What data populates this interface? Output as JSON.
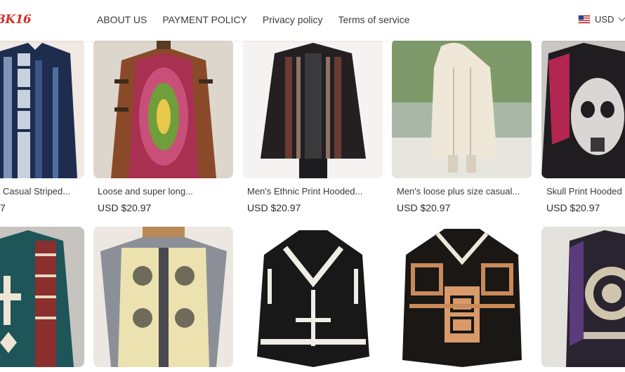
{
  "header": {
    "logo_text": "3K16",
    "nav": [
      "ABOUT US",
      "PAYMENT POLICY",
      "Privacy policy",
      "Terms of service"
    ],
    "currency": "USD"
  },
  "products_row1": [
    {
      "title": "Casual Striped...",
      "price": "7"
    },
    {
      "title": "Loose and super long...",
      "price": "USD $20.97"
    },
    {
      "title": "Men's Ethnic Print Hooded...",
      "price": "USD $20.97"
    },
    {
      "title": "Men's loose plus size casual...",
      "price": "USD $20.97"
    },
    {
      "title": "Skull Print Hooded",
      "price": "USD $20.97"
    }
  ],
  "products_row2": [
    {
      "image": "teal-cross-poncho"
    },
    {
      "image": "grey-beige-patterned-poncho"
    },
    {
      "image": "black-white-aztec-poncho"
    },
    {
      "image": "black-orange-greek-key-poncho"
    },
    {
      "image": "purple-aztec-calendar-poncho"
    }
  ]
}
